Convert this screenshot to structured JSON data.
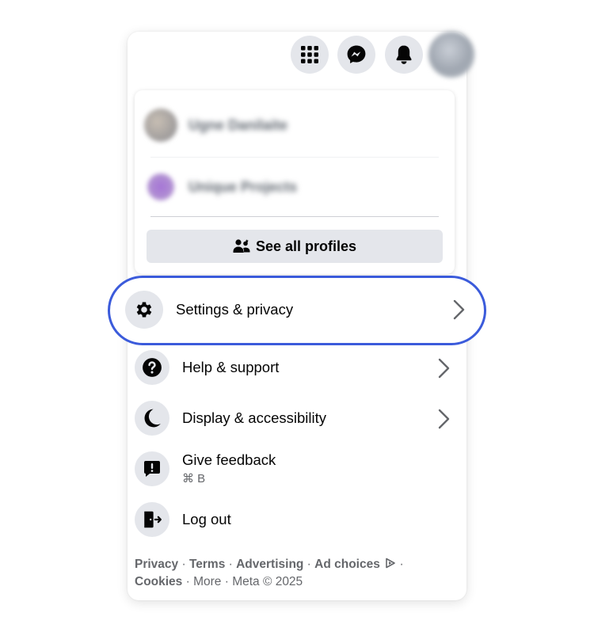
{
  "header": {
    "menu_icon": "grid-menu-icon",
    "messenger_icon": "messenger-icon",
    "notifications_icon": "bell-icon"
  },
  "profiles_panel": {
    "profiles": [
      {
        "name": "Ugne Danilaite"
      },
      {
        "name": "Unique Projects"
      }
    ],
    "see_all_label": "See all profiles"
  },
  "menu": {
    "settings": {
      "label": "Settings & privacy",
      "icon": "gear-icon"
    },
    "help": {
      "label": "Help & support",
      "icon": "question-icon"
    },
    "display": {
      "label": "Display & accessibility",
      "icon": "moon-icon"
    },
    "feedback": {
      "label": "Give feedback",
      "shortcut": "⌘ B",
      "icon": "feedback-icon"
    },
    "logout": {
      "label": "Log out",
      "icon": "logout-icon"
    }
  },
  "footer": {
    "privacy": "Privacy",
    "terms": "Terms",
    "advertising": "Advertising",
    "ad_choices": "Ad choices",
    "cookies": "Cookies",
    "more": "More",
    "copyright": "Meta © 2025",
    "separator": " · "
  },
  "colors": {
    "highlight": "#3b5bdb",
    "icon_bg": "#e4e6eb"
  }
}
